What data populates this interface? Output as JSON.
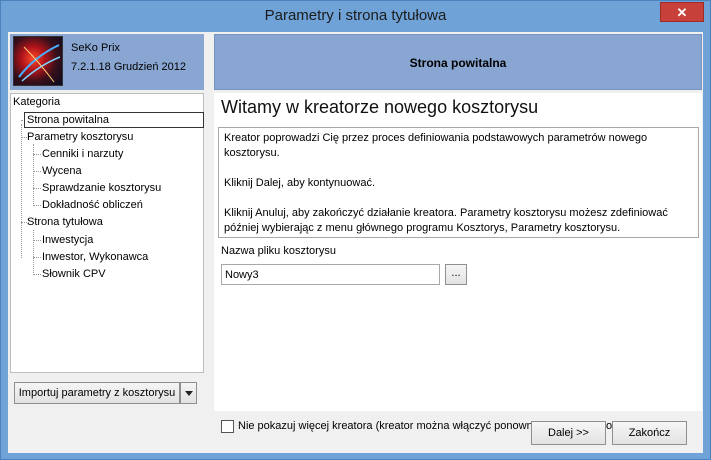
{
  "window": {
    "title": "Parametry i strona tytułowa",
    "close_label": "✕"
  },
  "app": {
    "name": "SeKo Prix",
    "version": "7.2.1.18 Grudzień 2012"
  },
  "tree": {
    "category_label": "Kategoria",
    "items": [
      {
        "label": "Strona powitalna",
        "level": 1,
        "selected": true
      },
      {
        "label": "Parametry kosztorysu",
        "level": 0
      },
      {
        "label": "Cenniki i narzuty",
        "level": 1
      },
      {
        "label": "Wycena",
        "level": 1
      },
      {
        "label": "Sprawdzanie kosztorysu",
        "level": 1
      },
      {
        "label": "Dokładność obliczeń",
        "level": 1
      },
      {
        "label": "Strona tytułowa",
        "level": 0
      },
      {
        "label": "Inwestycja",
        "level": 1
      },
      {
        "label": "Inwestor, Wykonawca",
        "level": 1
      },
      {
        "label": "Słownik CPV",
        "level": 1
      }
    ]
  },
  "left": {
    "import_label": "Importuj parametry z kosztorysu"
  },
  "page": {
    "header": "Strona powitalna",
    "title": "Witamy w kreatorze nowego kosztorysu",
    "desc1": "Kreator poprowadzi Cię przez proces definiowania podstawowych parametrów nowego kosztorysu.",
    "desc2": "Kliknij Dalej, aby kontynuować.",
    "desc3": "Kliknij Anuluj, aby zakończyć działanie kreatora. Parametry kosztorysu możesz zdefiniować później wybierając z menu głównego programu Kosztorys, Parametry kosztorysu.",
    "file_label": "Nazwa pliku kosztorysu",
    "file_value": "Nowy3",
    "browse_label": "...",
    "checkbox_label": "Nie pokazuj więcej kreatora (kreator można włączyć ponownie w opcjach programu)"
  },
  "buttons": {
    "next": "Dalej >>",
    "finish": "Zakończ"
  }
}
